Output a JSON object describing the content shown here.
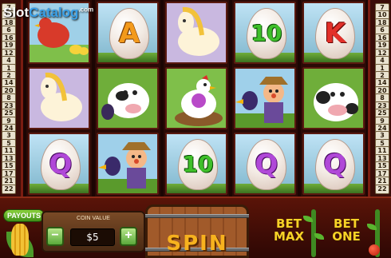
{
  "logo": {
    "text_a": "Slot",
    "text_b": "Catalog",
    "suffix": ".com"
  },
  "paylines": {
    "left": [
      "7",
      "10",
      "18",
      "6",
      "16",
      "19",
      "12",
      "4",
      "1",
      "2",
      "14",
      "20",
      "8",
      "23",
      "25",
      "9",
      "24",
      "3",
      "5",
      "11",
      "13",
      "15",
      "17",
      "21",
      "22"
    ],
    "right": [
      "7",
      "10",
      "18",
      "6",
      "16",
      "19",
      "12",
      "4",
      "1",
      "2",
      "14",
      "20",
      "8",
      "23",
      "25",
      "9",
      "24",
      "3",
      "5",
      "11",
      "13",
      "15",
      "17",
      "21",
      "22"
    ]
  },
  "reels": [
    {
      "cells": [
        {
          "kind": "picture",
          "name": "hen-and-chicks"
        },
        {
          "kind": "picture",
          "name": "horse"
        },
        {
          "kind": "egg",
          "symbol": "Q",
          "color": "purple"
        }
      ]
    },
    {
      "cells": [
        {
          "kind": "egg",
          "symbol": "A",
          "color": "orange"
        },
        {
          "kind": "picture",
          "name": "cow-and-crow"
        },
        {
          "kind": "picture",
          "name": "scarecrow-and-crow"
        }
      ]
    },
    {
      "cells": [
        {
          "kind": "picture",
          "name": "horse"
        },
        {
          "kind": "picture",
          "name": "hen-on-nest"
        },
        {
          "kind": "egg",
          "symbol": "10",
          "color": "green"
        }
      ]
    },
    {
      "cells": [
        {
          "kind": "egg",
          "symbol": "10",
          "color": "green"
        },
        {
          "kind": "picture",
          "name": "scarecrow-and-crow"
        },
        {
          "kind": "egg",
          "symbol": "Q",
          "color": "purple"
        }
      ]
    },
    {
      "cells": [
        {
          "kind": "egg",
          "symbol": "K",
          "color": "red"
        },
        {
          "kind": "picture",
          "name": "cow"
        },
        {
          "kind": "egg",
          "symbol": "Q",
          "color": "purple"
        }
      ]
    }
  ],
  "controls": {
    "payouts_label": "PAYOUTS",
    "coin_value_label": "COIN VALUE",
    "coin_value": "$5",
    "minus_label": "−",
    "plus_label": "+",
    "spin_label": "SPIN",
    "bet_max_line1": "BET",
    "bet_max_line2": "MAX",
    "bet_one_line1": "BET",
    "bet_one_line2": "ONE"
  },
  "colors": {
    "frame": "#3a0d08",
    "green_symbol": "#3fbf2a",
    "orange_symbol": "#f39a1c",
    "red_symbol": "#e2302a",
    "purple_symbol": "#b048d8",
    "bet_text": "#f7d226"
  }
}
